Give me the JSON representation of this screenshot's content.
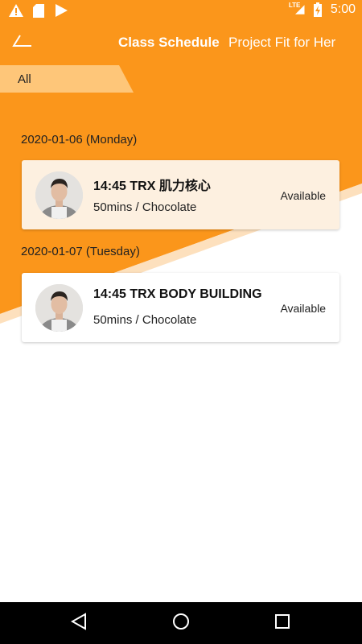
{
  "status_bar": {
    "time": "5:00",
    "network": "LTE",
    "icons": [
      "warning-icon",
      "sd-card-icon",
      "play-store-icon",
      "signal-icon",
      "battery-icon"
    ]
  },
  "app_bar": {
    "back_icon": "back-arrow-icon",
    "title": "Class Schedule",
    "subtitle": "Project Fit for Her"
  },
  "filter": {
    "label": "All"
  },
  "schedule": [
    {
      "date": "2020-01-06 (Monday)",
      "class_name": "14:45 TRX 肌力核心",
      "meta": "50mins / Chocolate",
      "status": "Available"
    },
    {
      "date": "2020-01-07 (Tuesday)",
      "class_name": "14:45 TRX BODY BUILDING",
      "meta": "50mins / Chocolate",
      "status": "Available"
    }
  ],
  "nav_bar": {
    "icons": [
      "back-triangle-icon",
      "home-circle-icon",
      "recents-square-icon"
    ]
  },
  "colors": {
    "brand_orange": "#fb961b",
    "tab_light": "#fec679",
    "highlight_card": "#fdf0e0"
  }
}
